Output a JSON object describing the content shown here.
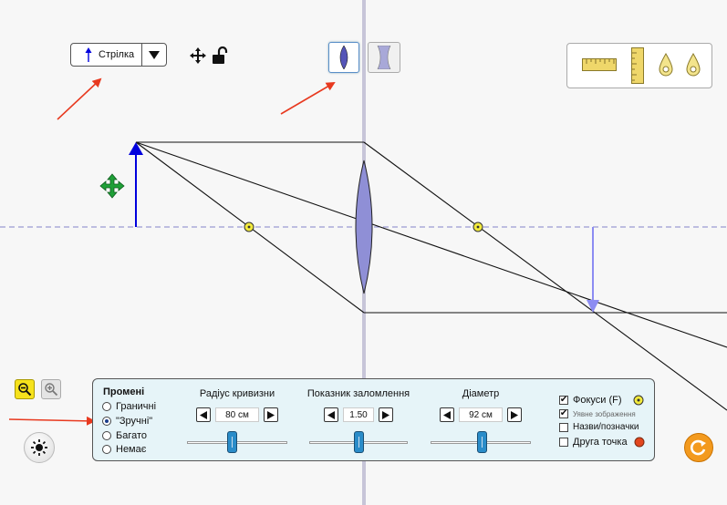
{
  "toolbar": {
    "object_selector_label": "Стрілка"
  },
  "panel": {
    "rays_title": "Промені",
    "rays_options": [
      {
        "label": "Граничні",
        "selected": false
      },
      {
        "label": "\"Зручні\"",
        "selected": true
      },
      {
        "label": "Багато",
        "selected": false
      },
      {
        "label": "Немає",
        "selected": false
      }
    ],
    "controls": [
      {
        "title": "Радіус кривизни",
        "value": "80 см",
        "slider_fraction": 0.49
      },
      {
        "title": "Показник заломлення",
        "value": "1.50",
        "slider_fraction": 0.5
      },
      {
        "title": "Діаметр",
        "value": "92 см",
        "slider_fraction": 0.5
      }
    ],
    "options": [
      {
        "label": "Фокуси (F)",
        "checked": true
      },
      {
        "label": "Уявне зображення",
        "checked": true
      },
      {
        "label": "Назви/позначки",
        "checked": false
      },
      {
        "label": "Друга точка",
        "checked": false
      }
    ]
  },
  "colors": {
    "object_arrow": "#0000dd",
    "image_arrow": "#8c8cf2",
    "lens_fill": "#8f8fd6",
    "focus_point": "#f2ea3c",
    "optical_axis": "#9a9ad2",
    "move_handle": "#1fa037",
    "second_point": "#e2461e",
    "reset_button": "#f39a1e",
    "annotation_arrow": "#e8391f"
  }
}
